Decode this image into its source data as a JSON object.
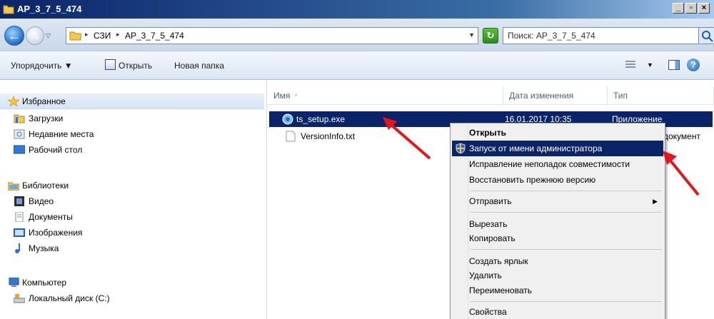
{
  "window": {
    "title": "AP_3_7_5_474",
    "controls": [
      "_",
      "8",
      "×"
    ]
  },
  "address": {
    "crumbs": [
      "СЗИ",
      "AP_3_7_5_474"
    ],
    "search_placeholder": "Поиск: AP_3_7_5_474"
  },
  "commands": {
    "organize": "Упорядочить ▼",
    "open": "Открыть",
    "new_folder": "Новая папка"
  },
  "nav": {
    "favorites": "Избранное",
    "downloads": "Загрузки",
    "recent": "Недавние места",
    "desktop": "Рабочий стол",
    "libraries": "Библиотеки",
    "video": "Видео",
    "documents": "Документы",
    "pictures": "Изображения",
    "music": "Музыка",
    "computer": "Компьютер",
    "local_disk": "Локальный диск (C:)"
  },
  "columns": {
    "name": "Имя",
    "date": "Дата изменения",
    "type": "Тип"
  },
  "files": [
    {
      "name": "ts_setup.exe",
      "date": "16.01.2017 10:35",
      "type": "Приложение"
    },
    {
      "name": "VersionInfo.txt",
      "date": "",
      "type": "документ"
    }
  ],
  "context_menu": {
    "open": "Открыть",
    "run_as_admin": "Запуск от имени администратора",
    "troubleshoot": "Исправление неполадок совместимости",
    "restore": "Восстановить прежнюю версию",
    "send_to": "Отправить",
    "cut": "Вырезать",
    "copy": "Копировать",
    "shortcut": "Создать ярлык",
    "delete": "Удалить",
    "rename": "Переименовать",
    "properties": "Свойства"
  },
  "colors": {
    "selection": "#0a246a",
    "arrow": "#e8141c"
  }
}
